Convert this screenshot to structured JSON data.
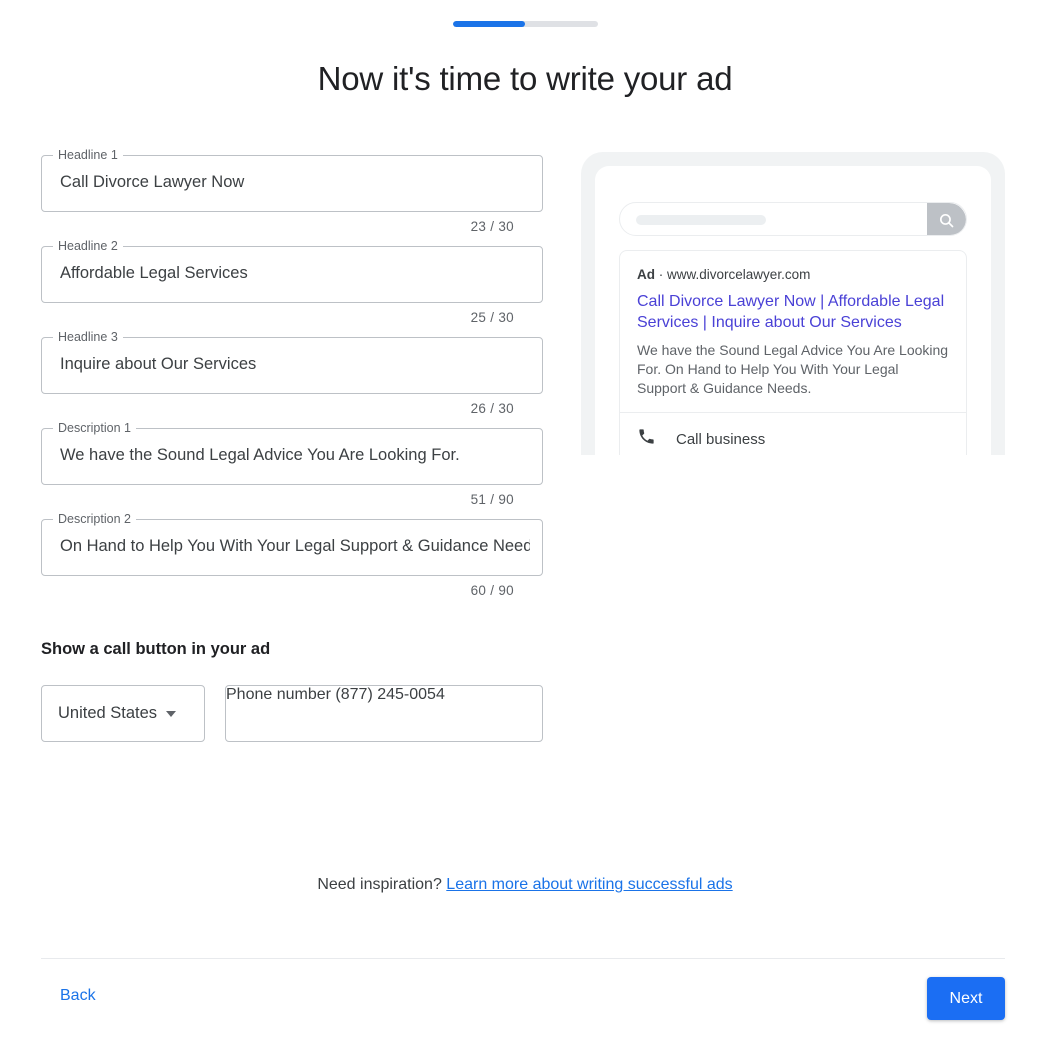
{
  "progress": {
    "percent": 50
  },
  "header": {
    "title": "Now it's time to write your ad"
  },
  "form": {
    "fields": [
      {
        "label": "Headline 1",
        "value": "Call Divorce Lawyer Now",
        "counter": "23 / 30"
      },
      {
        "label": "Headline 2",
        "value": "Affordable Legal Services",
        "counter": "25 / 30"
      },
      {
        "label": "Headline 3",
        "value": "Inquire about Our Services",
        "counter": "26 / 30"
      },
      {
        "label": "Description 1",
        "value": "We have the Sound Legal Advice You Are Looking For.",
        "counter": "51 / 90"
      },
      {
        "label": "Description 2",
        "value": "On Hand to Help You With Your Legal Support & Guidance Needs.",
        "counter": "60 / 90"
      }
    ],
    "call_section": {
      "heading": "Show a call button in your ad",
      "country": "United States",
      "phone_label": "Phone number",
      "phone_value": "(877) 245-0054"
    }
  },
  "preview": {
    "search_placeholder": "",
    "search_icon": "search-icon",
    "ad": {
      "badge": "Ad",
      "separator": "·",
      "url": "www.divorcelawyer.com",
      "headline": "Call Divorce Lawyer Now | Affordable Legal Services | Inquire about Our Services",
      "description": "We have the Sound Legal Advice You Are Looking For. On Hand to Help You With Your Legal Support & Guidance Needs.",
      "call_label": "Call business",
      "call_icon": "phone-icon"
    }
  },
  "inspiration": {
    "prompt": "Need inspiration?",
    "link": "Learn more about writing successful ads"
  },
  "footer": {
    "back_label": "Back",
    "next_label": "Next"
  },
  "colors": {
    "accent": "#1a73e8",
    "next_button": "#1b6ef3",
    "ad_headline": "#4a41d6",
    "field_border": "#bdc1c6",
    "progress_track": "#dfe1e5"
  }
}
